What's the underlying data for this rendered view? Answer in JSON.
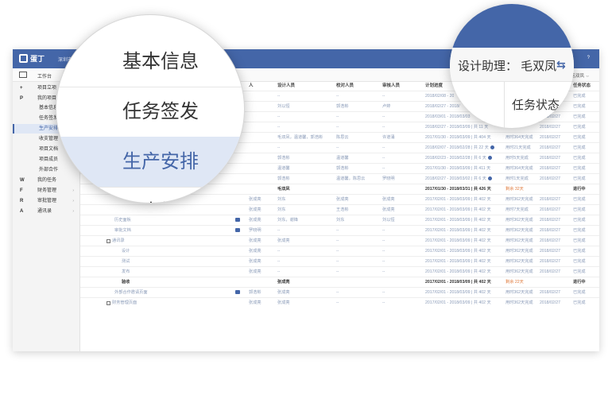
{
  "app": {
    "logo": "蛋丁",
    "company": "深圳市蛋丁科技",
    "topbar_right": "?"
  },
  "subbar": {
    "tab": "工作台",
    "right": "毛双凤 ⇔"
  },
  "sidebar": {
    "items": [
      {
        "letter": "+",
        "label": "项目立项",
        "top": true
      },
      {
        "letter": "P",
        "label": "我的项目",
        "top": true
      },
      {
        "label": "基本信息"
      },
      {
        "label": "任务签发"
      },
      {
        "label": "生产安排",
        "active": true
      },
      {
        "label": "收支管理"
      },
      {
        "label": "项目文档"
      },
      {
        "label": "项目成员"
      },
      {
        "label": "外部合作"
      },
      {
        "letter": "W",
        "label": "我的任务",
        "top": true
      },
      {
        "letter": "F",
        "label": "财务管理",
        "top": true,
        "caret": "›"
      },
      {
        "letter": "R",
        "label": "审批管理",
        "top": true,
        "caret": "›"
      },
      {
        "letter": "A",
        "label": "通讯录",
        "top": true,
        "caret": "›"
      }
    ]
  },
  "grid": {
    "headers": [
      "人",
      "设计人员",
      "校对人员",
      "审核人员",
      "计划进度",
      "",
      "",
      "任务状态"
    ],
    "rows": [
      {
        "assignee": "",
        "designer": "--",
        "checker": "--",
        "reviewer": "--",
        "plan": "2018/02/08 - 20",
        "remark": "",
        "date": "",
        "status": "已完成"
      },
      {
        "assignee": "",
        "designer": "刘以恒",
        "checker": "郭浩彬",
        "reviewer": "卢婷",
        "plan": "2018/02/27 - 2018/",
        "remark": "",
        "date": "",
        "status": "已完成"
      },
      {
        "assignee": "",
        "designer": "--",
        "checker": "--",
        "reviewer": "--",
        "plan": "2018/03/01 - 2018/03/03",
        "remark": "",
        "date": "2018/02/27",
        "status": "已完成"
      },
      {
        "assignee": "",
        "designer": "--",
        "checker": "--",
        "reviewer": "--",
        "plan": "2018/02/27 - 2018/03/09 | 共 11 天",
        "remark": "",
        "date": "2018/02/27",
        "status": "已完成"
      },
      {
        "assignee": "",
        "designer": "毛双凤，温道馨，郭浩彬",
        "checker": "陈思云",
        "reviewer": "许道涌",
        "plan": "2017/01/30 - 2018/03/09 | 共 404 天",
        "remark": "用时364天完成",
        "date": "2018/02/27",
        "status": "已完成"
      },
      {
        "assignee": "",
        "designer": "--",
        "checker": "--",
        "reviewer": "--",
        "plan": "2018/02/07 - 2018/02/28 | 共 22 天",
        "info": true,
        "remark": "用时21天完成",
        "date": "2018/02/27",
        "status": "已完成"
      },
      {
        "assignee": "",
        "designer": "郭浩彬",
        "checker": "温道馨",
        "reviewer": "--",
        "plan": "2018/02/23 - 2018/02/28 | 共 6 天",
        "info": true,
        "remark": "用时5天完成",
        "date": "2018/02/27",
        "status": "已完成"
      },
      {
        "assignee": "",
        "designer": "温道馨",
        "checker": "郭浩彬",
        "reviewer": "--",
        "plan": "2017/01/30 - 2018/03/09 | 共 411 天",
        "remark": "用时364天完成",
        "date": "2018/02/27",
        "status": "已完成"
      },
      {
        "assignee": "",
        "designer": "郭浩彬",
        "checker": "温道馨，陈思云",
        "reviewer": "罗晓明",
        "plan": "2018/02/27 - 2018/03/02 | 共 6 天",
        "info": true,
        "remark": "用时1天完成",
        "date": "2018/02/27",
        "status": "已完成"
      },
      {
        "bold": true,
        "assignee": "",
        "designer": "毛双凤",
        "checker": "",
        "reviewer": "",
        "plan": "2017/01/30 - 2018/03/31 | 共 426 天",
        "remark": "剩余 32天",
        "date": "",
        "status": "进行中"
      },
      {
        "assignee": "张成亮",
        "designer": "刘东",
        "checker": "张成亮",
        "reviewer": "张成亮",
        "plan": "2017/02/01 - 2018/03/09 | 共 402 天",
        "remark": "用时362天完成",
        "date": "2018/02/27",
        "status": "已完成"
      },
      {
        "assignee": "张成亮",
        "designer": "刘东",
        "checker": "王浩彬",
        "reviewer": "张成亮",
        "plan": "2017/02/01 - 2018/03/09 | 共 402 天",
        "remark": "用时7天完成",
        "date": "2018/02/27",
        "status": "已完成"
      },
      {
        "name": "历史面板",
        "comment": true,
        "assignee": "张成亮",
        "designer": "刘东，谢锋",
        "checker": "刘东",
        "reviewer": "刘以恒",
        "plan": "2017/02/01 - 2018/03/09 | 共 402 天",
        "remark": "用时362天完成",
        "date": "2018/02/27",
        "status": "已完成"
      },
      {
        "name": "审批文档",
        "comment": true,
        "assignee": "罗晓明",
        "designer": "--",
        "checker": "--",
        "reviewer": "--",
        "plan": "2017/02/01 - 2018/03/09 | 共 402 天",
        "remark": "用时362天完成",
        "date": "2018/02/27",
        "status": "已完成"
      },
      {
        "name": "通讯录",
        "box": "-",
        "assignee": "张成亮",
        "designer": "张成亮",
        "checker": "--",
        "reviewer": "--",
        "plan": "2017/02/01 - 2018/03/09 | 共 402 天",
        "remark": "用时362天完成",
        "date": "2018/02/27",
        "status": "已完成"
      },
      {
        "name": "设计",
        "indent": 2,
        "assignee": "张成亮",
        "designer": "--",
        "checker": "--",
        "reviewer": "--",
        "plan": "2017/02/01 - 2018/03/09 | 共 402 天",
        "remark": "用时362天完成",
        "date": "2018/02/27",
        "status": "已完成"
      },
      {
        "name": "测试",
        "indent": 2,
        "assignee": "张成亮",
        "designer": "--",
        "checker": "--",
        "reviewer": "--",
        "plan": "2017/02/01 - 2018/03/09 | 共 402 天",
        "remark": "用时362天完成",
        "date": "2018/02/27",
        "status": "已完成"
      },
      {
        "name": "发布",
        "indent": 2,
        "assignee": "张成亮",
        "designer": "--",
        "checker": "--",
        "reviewer": "--",
        "plan": "2017/02/01 - 2018/03/09 | 共 402 天",
        "remark": "用时362天完成",
        "date": "2018/02/27",
        "status": "已完成"
      },
      {
        "name": "验收",
        "indent": 2,
        "bold": true,
        "assignee": "",
        "designer": "张成亮",
        "checker": "",
        "reviewer": "",
        "plan": "2017/02/01 - 2018/03/09 | 共 402 天",
        "remark": "剩余 22天",
        "date": "",
        "status": "进行中"
      },
      {
        "name": "外部合作邀请页面",
        "comment": true,
        "assignee": "郭浩彬",
        "designer": "张成亮",
        "checker": "--",
        "reviewer": "--",
        "plan": "2017/02/01 - 2018/03/09 | 共 402 天",
        "remark": "用时362天完成",
        "date": "2018/02/27",
        "status": "已完成"
      },
      {
        "name": "财务管理页面",
        "box": "-",
        "assignee": "张成亮",
        "designer": "张成亮",
        "checker": "--",
        "reviewer": "--",
        "plan": "2017/02/01 - 2018/03/09 | 共 402 天",
        "remark": "用时362天完成",
        "date": "2018/02/27",
        "status": "已完成"
      }
    ]
  },
  "magnifier_left": {
    "items": [
      "基本信息",
      "任务签发",
      "生产安排",
      "收支管理"
    ],
    "active_index": 2
  },
  "magnifier_right": {
    "design_assistant": "设计助理：  毛双凤",
    "sync_icon": "⇆",
    "column": "任务状态"
  },
  "colors": {
    "brand": "#4466a8",
    "active_bg": "#dfe7f5",
    "late": "#e07a3c"
  }
}
